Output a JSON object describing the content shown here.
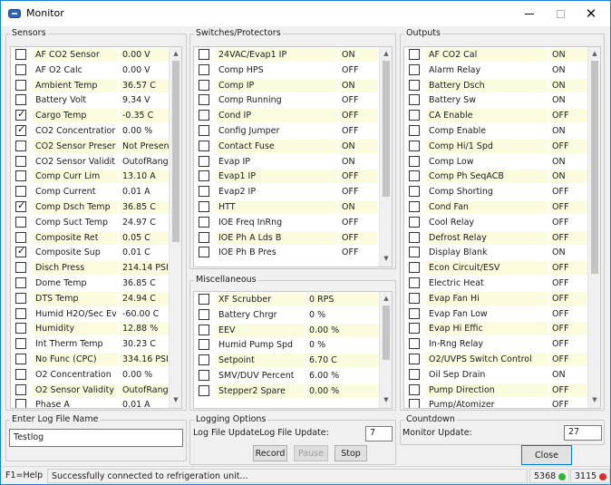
{
  "window": {
    "title": "Monitor"
  },
  "sensors": {
    "title": "Sensors",
    "rows": [
      {
        "name": "AF CO2 Sensor",
        "value": "0.00 V",
        "checked": false,
        "hl": true
      },
      {
        "name": "AF O2 Calc",
        "value": "0.00 V",
        "checked": false,
        "hl": false
      },
      {
        "name": "Ambient Temp",
        "value": "36.57 C",
        "checked": false,
        "hl": true
      },
      {
        "name": "Battery Volt",
        "value": "9.34 V",
        "checked": false,
        "hl": false
      },
      {
        "name": "Cargo Temp",
        "value": "-0.35 C",
        "checked": true,
        "hl": true
      },
      {
        "name": "CO2 Concentratior",
        "value": "0.00 %",
        "checked": true,
        "hl": false
      },
      {
        "name": "CO2 Sensor Preser",
        "value": "Not Presen",
        "checked": false,
        "hl": true
      },
      {
        "name": "CO2 Sensor Validit",
        "value": "OutofRang",
        "checked": false,
        "hl": false
      },
      {
        "name": "Comp Curr Lim",
        "value": "13.10 A",
        "checked": false,
        "hl": true
      },
      {
        "name": "Comp Current",
        "value": "0.01 A",
        "checked": false,
        "hl": false
      },
      {
        "name": "Comp Dsch Temp",
        "value": "36.85 C",
        "checked": true,
        "hl": true
      },
      {
        "name": "Comp Suct Temp",
        "value": "24.97 C",
        "checked": false,
        "hl": false
      },
      {
        "name": "Composite Ret",
        "value": "0.05 C",
        "checked": false,
        "hl": true
      },
      {
        "name": "Composite Sup",
        "value": "0.01 C",
        "checked": true,
        "hl": false
      },
      {
        "name": "Disch Press",
        "value": "214.14 PSI",
        "checked": false,
        "hl": true
      },
      {
        "name": "Dome Temp",
        "value": "36.85 C",
        "checked": false,
        "hl": false
      },
      {
        "name": "DTS Temp",
        "value": "24.94 C",
        "checked": false,
        "hl": true
      },
      {
        "name": "Humid H2O/Sec Ev",
        "value": "-60.00 C",
        "checked": false,
        "hl": false
      },
      {
        "name": "Humidity",
        "value": "12.88 %",
        "checked": false,
        "hl": true
      },
      {
        "name": "Int Therm Temp",
        "value": "30.23 C",
        "checked": false,
        "hl": false
      },
      {
        "name": "No Func (CPC)",
        "value": "334.16 PSI",
        "checked": false,
        "hl": true
      },
      {
        "name": "O2 Concentration",
        "value": "0.00 %",
        "checked": false,
        "hl": false
      },
      {
        "name": "O2 Sensor Validity",
        "value": "OutofRang",
        "checked": false,
        "hl": true
      },
      {
        "name": "Phase A",
        "value": "0.01 A",
        "checked": false,
        "hl": false
      }
    ]
  },
  "switches": {
    "title": "Switches/Protectors",
    "rows": [
      {
        "name": "24VAC/Evap1 IP",
        "value": "ON",
        "checked": false,
        "hl": true
      },
      {
        "name": "Comp HPS",
        "value": "OFF",
        "checked": false,
        "hl": false
      },
      {
        "name": "Comp IP",
        "value": "ON",
        "checked": false,
        "hl": true
      },
      {
        "name": "Comp Running",
        "value": "OFF",
        "checked": false,
        "hl": false
      },
      {
        "name": "Cond IP",
        "value": "OFF",
        "checked": false,
        "hl": true
      },
      {
        "name": "Config Jumper",
        "value": "OFF",
        "checked": false,
        "hl": false
      },
      {
        "name": "Contact Fuse",
        "value": "ON",
        "checked": false,
        "hl": true
      },
      {
        "name": "Evap IP",
        "value": "ON",
        "checked": false,
        "hl": false
      },
      {
        "name": "Evap1 IP",
        "value": "OFF",
        "checked": false,
        "hl": true
      },
      {
        "name": "Evap2 IP",
        "value": "OFF",
        "checked": false,
        "hl": false
      },
      {
        "name": "HTT",
        "value": "ON",
        "checked": false,
        "hl": true
      },
      {
        "name": "IOE Freq InRng",
        "value": "OFF",
        "checked": false,
        "hl": false
      },
      {
        "name": "IOE Ph A Lds B",
        "value": "OFF",
        "checked": false,
        "hl": true
      },
      {
        "name": "IOE Ph B Pres",
        "value": "OFF",
        "checked": false,
        "hl": false
      }
    ]
  },
  "misc": {
    "title": "Miscellaneous",
    "rows": [
      {
        "name": "XF Scrubber",
        "value": "0 RPS",
        "checked": false,
        "hl": true
      },
      {
        "name": "Battery Chrgr",
        "value": "0 %",
        "checked": false,
        "hl": false
      },
      {
        "name": "EEV",
        "value": "0.00 %",
        "checked": false,
        "hl": true
      },
      {
        "name": "Humid Pump Spd",
        "value": "0 %",
        "checked": false,
        "hl": false
      },
      {
        "name": "Setpoint",
        "value": "6.70 C",
        "checked": false,
        "hl": true
      },
      {
        "name": "SMV/DUV Percent",
        "value": "6.00 %",
        "checked": false,
        "hl": false
      },
      {
        "name": "Stepper2 Spare",
        "value": "0.00 %",
        "checked": false,
        "hl": true
      }
    ]
  },
  "outputs": {
    "title": "Outputs",
    "rows": [
      {
        "name": "AF CO2 Cal",
        "value": "ON",
        "checked": false,
        "hl": true
      },
      {
        "name": "Alarm Relay",
        "value": "ON",
        "checked": false,
        "hl": false
      },
      {
        "name": "Battery Dsch",
        "value": "ON",
        "checked": false,
        "hl": true
      },
      {
        "name": "Battery Sw",
        "value": "ON",
        "checked": false,
        "hl": false
      },
      {
        "name": "CA Enable",
        "value": "OFF",
        "checked": false,
        "hl": true
      },
      {
        "name": "Comp Enable",
        "value": "ON",
        "checked": false,
        "hl": false
      },
      {
        "name": "Comp Hi/1 Spd",
        "value": "OFF",
        "checked": false,
        "hl": true
      },
      {
        "name": "Comp Low",
        "value": "ON",
        "checked": false,
        "hl": false
      },
      {
        "name": "Comp Ph SeqACB",
        "value": "ON",
        "checked": false,
        "hl": true
      },
      {
        "name": "Comp Shorting",
        "value": "OFF",
        "checked": false,
        "hl": false
      },
      {
        "name": "Cond Fan",
        "value": "OFF",
        "checked": false,
        "hl": true
      },
      {
        "name": "Cool Relay",
        "value": "OFF",
        "checked": false,
        "hl": false
      },
      {
        "name": "Defrost Relay",
        "value": "OFF",
        "checked": false,
        "hl": true
      },
      {
        "name": "Display Blank",
        "value": "ON",
        "checked": false,
        "hl": false
      },
      {
        "name": "Econ Circuit/ESV",
        "value": "OFF",
        "checked": false,
        "hl": true
      },
      {
        "name": "Electric Heat",
        "value": "OFF",
        "checked": false,
        "hl": false
      },
      {
        "name": "Evap Fan Hi",
        "value": "OFF",
        "checked": false,
        "hl": true
      },
      {
        "name": "Evap Fan Low",
        "value": "OFF",
        "checked": false,
        "hl": false
      },
      {
        "name": "Evap Hi Effic",
        "value": "OFF",
        "checked": false,
        "hl": true
      },
      {
        "name": "In-Rng Relay",
        "value": "OFF",
        "checked": false,
        "hl": false
      },
      {
        "name": "O2/UVPS Switch Control",
        "value": "OFF",
        "checked": false,
        "hl": true
      },
      {
        "name": "Oil Sep Drain",
        "value": "ON",
        "checked": false,
        "hl": false
      },
      {
        "name": "Pump Direction",
        "value": "OFF",
        "checked": false,
        "hl": true
      },
      {
        "name": "Pump/Atomizer",
        "value": "OFF",
        "checked": false,
        "hl": false
      }
    ]
  },
  "log": {
    "title": "Enter Log File Name",
    "filename": "Testlog"
  },
  "logging": {
    "title": "Logging Options",
    "update_label": "Log File UpdateLog File Update:",
    "update_value": "7",
    "record": "Record",
    "pause": "Pause",
    "stop": "Stop"
  },
  "countdown": {
    "title": "Countdown",
    "label": "Monitor Update:",
    "value": "27"
  },
  "close_label": "Close",
  "status": {
    "help": "F1=Help",
    "message": "Successfully connected to refrigeration unit...",
    "port1": "5368",
    "port2": "3115",
    "dot1_color": "#2fb52f",
    "dot2_color": "#d9302c"
  }
}
